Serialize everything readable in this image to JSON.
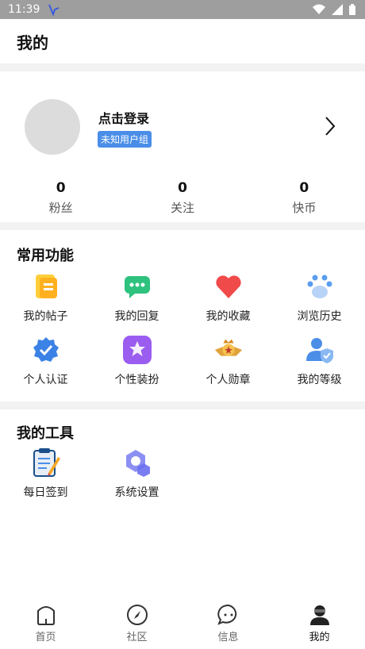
{
  "status": {
    "time": "11:39"
  },
  "header": {
    "title": "我的"
  },
  "profile": {
    "login_text": "点击登录",
    "user_group": "未知用户组"
  },
  "stats": [
    {
      "value": "0",
      "label": "粉丝"
    },
    {
      "value": "0",
      "label": "关注"
    },
    {
      "value": "0",
      "label": "快币"
    }
  ],
  "functions": {
    "title": "常用功能",
    "items": [
      {
        "label": "我的帖子",
        "icon": "post-icon"
      },
      {
        "label": "我的回复",
        "icon": "reply-icon"
      },
      {
        "label": "我的收藏",
        "icon": "favorite-icon"
      },
      {
        "label": "浏览历史",
        "icon": "history-icon"
      },
      {
        "label": "个人认证",
        "icon": "verify-icon"
      },
      {
        "label": "个性装扮",
        "icon": "dress-up-icon"
      },
      {
        "label": "个人勋章",
        "icon": "medal-icon"
      },
      {
        "label": "我的等级",
        "icon": "level-icon"
      }
    ]
  },
  "tools": {
    "title": "我的工具",
    "items": [
      {
        "label": "每日签到",
        "icon": "checkin-icon"
      },
      {
        "label": "系统设置",
        "icon": "settings-icon"
      }
    ]
  },
  "tabbar": [
    {
      "label": "首页",
      "icon": "home-icon"
    },
    {
      "label": "社区",
      "icon": "compass-icon"
    },
    {
      "label": "信息",
      "icon": "message-icon"
    },
    {
      "label": "我的",
      "icon": "user-icon"
    }
  ],
  "colors": {
    "accent": "#4a8ee8",
    "divider": "#f2f2f2"
  }
}
